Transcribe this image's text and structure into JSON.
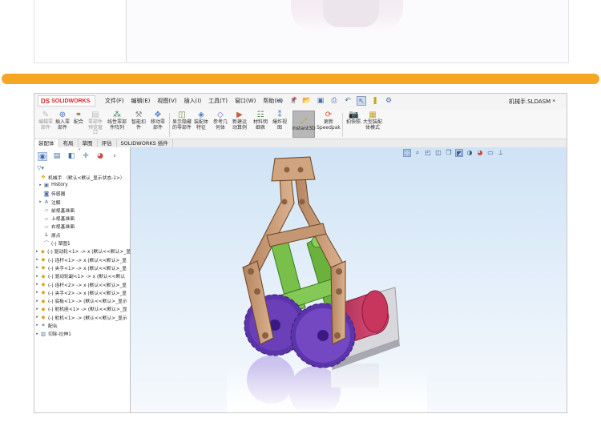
{
  "app": {
    "logo_mark": "DS",
    "logo_text": "SOLIDWORKS",
    "menus": [
      "文件(F)",
      "编辑(E)",
      "视图(V)",
      "插入(I)",
      "工具(T)",
      "窗口(W)",
      "帮助(H)"
    ],
    "document_title": "机械手.SLDASM *",
    "pin_icon": "pin-icon"
  },
  "quick_access": {
    "icons": [
      "home-icon",
      "new-document-icon",
      "open-icon",
      "save-icon",
      "print-icon",
      "undo-icon",
      "select-icon",
      "rebuild-icon",
      "options-icon"
    ]
  },
  "ribbon": {
    "buttons": [
      {
        "label": "编辑零部件",
        "icon": "edit-part-icon",
        "enabled": false
      },
      {
        "label": "插入零部件",
        "icon": "insert-component-icon",
        "enabled": true
      },
      {
        "label": "配合",
        "icon": "mate-icon",
        "enabled": true
      },
      {
        "label": "零部件预览窗口",
        "icon": "preview-window-icon",
        "enabled": false
      },
      {
        "label": "线性零部件阵列",
        "icon": "linear-pattern-icon",
        "enabled": true
      },
      {
        "label": "智能扣件",
        "icon": "smart-fastener-icon",
        "enabled": true
      },
      {
        "label": "移动零部件",
        "icon": "move-component-icon",
        "enabled": true
      },
      {
        "label": "显示隐藏的零部件",
        "icon": "show-hidden-icon",
        "enabled": true
      },
      {
        "label": "装配体特征",
        "icon": "assembly-feature-icon",
        "enabled": true
      },
      {
        "label": "参考几何体",
        "icon": "reference-geometry-icon",
        "enabled": true
      },
      {
        "label": "新建运动算例",
        "icon": "motion-study-icon",
        "enabled": true
      },
      {
        "label": "材料明细表",
        "icon": "bom-icon",
        "enabled": true
      },
      {
        "label": "爆炸视图",
        "icon": "exploded-view-icon",
        "enabled": true
      },
      {
        "label": "Instant3D",
        "icon": "instant3d-icon",
        "enabled": true,
        "active": true
      },
      {
        "label": "更新Speedpak",
        "icon": "speedpak-icon",
        "enabled": true
      },
      {
        "label": "拍快照",
        "icon": "snapshot-icon",
        "enabled": true
      },
      {
        "label": "大型装配体模式",
        "icon": "large-assembly-icon",
        "enabled": true
      }
    ]
  },
  "tabs": [
    "装配体",
    "布局",
    "草图",
    "评估",
    "SOLIDWORKS 插件"
  ],
  "panel": {
    "tab_icons": [
      "feature-manager-icon",
      "property-manager-icon",
      "configuration-manager-icon",
      "dimxpert-icon",
      "display-manager-icon"
    ],
    "filter_icon": "filter-icon",
    "tree": [
      {
        "label": "机械手 （默认<默认_显示状态-1>）",
        "icon": "assembly-icon",
        "arrow": ""
      },
      {
        "label": "History",
        "icon": "history-icon",
        "arrow": "▸"
      },
      {
        "label": "传感器",
        "icon": "sensor-icon",
        "arrow": ""
      },
      {
        "label": "注解",
        "icon": "annotation-icon",
        "arrow": "▸"
      },
      {
        "label": "前视基准面",
        "icon": "plane-icon",
        "arrow": ""
      },
      {
        "label": "上视基准面",
        "icon": "plane-icon",
        "arrow": ""
      },
      {
        "label": "右视基准面",
        "icon": "plane-icon",
        "arrow": ""
      },
      {
        "label": "原点",
        "icon": "origin-icon",
        "arrow": ""
      },
      {
        "label": "(-) 草图1",
        "icon": "sketch-icon",
        "arrow": ""
      },
      {
        "label": "(-) 驱动轮<1> -> x (默认<<默认>_显",
        "icon": "part-icon",
        "arrow": "▸"
      },
      {
        "label": "(-) 连杆<1> -> x (默认<<默认>_显",
        "icon": "part-icon",
        "arrow": "▸"
      },
      {
        "label": "(-) 夹手<1> -> x (默认<<默认>_显",
        "icon": "part-icon",
        "arrow": "▸"
      },
      {
        "label": "(-) 驱动轮副<1> -> x (默认<<默认",
        "icon": "part-icon",
        "arrow": "▸"
      },
      {
        "label": "(-) 连杆<2> -> x (默认<<默认>_显",
        "icon": "part-icon",
        "arrow": "▸"
      },
      {
        "label": "(-) 夹手<2> -> x (默认<<默认>_显",
        "icon": "part-icon",
        "arrow": "▸"
      },
      {
        "label": "(-) 底板<1> -> (默认<<默认>_显示",
        "icon": "part-icon",
        "arrow": "▸"
      },
      {
        "label": "(-) 舵机座<1> -> (默认<<默认>_显",
        "icon": "part-icon",
        "arrow": "▸"
      },
      {
        "label": "(-) 舵机<1> -> (默认<<默认>_显示",
        "icon": "part-icon",
        "arrow": "▸"
      },
      {
        "label": "配合",
        "icon": "mates-icon",
        "arrow": "▸"
      },
      {
        "label": "切除-拉伸1",
        "icon": "cut-extrude-icon",
        "arrow": "▸"
      }
    ]
  },
  "viewport": {
    "tool_icons": [
      "zoom-fit-icon",
      "zoom-area-icon",
      "previous-view-icon",
      "section-view-icon",
      "view-orientation-icon",
      "display-style-icon",
      "hide-show-icon",
      "edit-appearance-icon",
      "apply-scene-icon",
      "view-settings-icon"
    ],
    "colors": {
      "gripper": "#c89a76",
      "link": "#78c04a",
      "gear": "#6a3fb8",
      "servo": "#c83a64",
      "base": "#d8d8dc",
      "background_top": "#cfe3f5"
    }
  }
}
